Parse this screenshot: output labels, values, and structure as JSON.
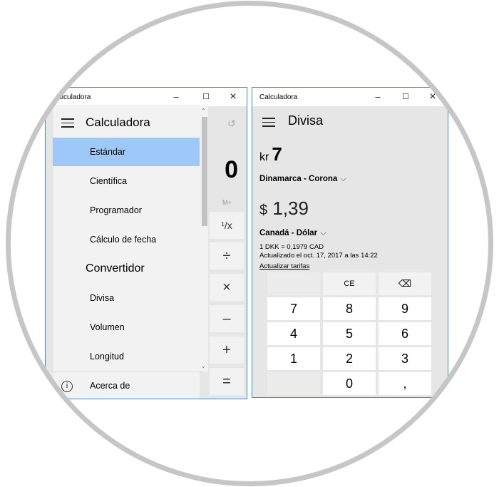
{
  "standard_window": {
    "title": "Calculadora",
    "controls": {
      "minimize": "–",
      "maximize": "☐",
      "close": "×"
    },
    "display": {
      "value": "0",
      "memory": "M+"
    },
    "history_icon": "history-icon",
    "operators": [
      "¹/x",
      "÷",
      "×",
      "–",
      "+",
      "="
    ],
    "nav": {
      "title": "Calculadora",
      "calc_items": [
        "Estándar",
        "Científica",
        "Programador",
        "Cálculo de fecha"
      ],
      "selected": "Estándar",
      "converter_header": "Convertidor",
      "converter_items": [
        "Divisa",
        "Volumen",
        "Longitud"
      ],
      "about": "Acerca de"
    }
  },
  "currency_window": {
    "title": "Calculadora",
    "controls": {
      "minimize": "–",
      "maximize": "☐",
      "close": "×"
    },
    "mode_title": "Divisa",
    "from": {
      "symbol": "kr",
      "value": "7",
      "currency": "Dinamarca - Corona"
    },
    "to": {
      "symbol": "$",
      "value": "1,39",
      "currency": "Canadá - Dólar"
    },
    "rate_line": "1 DKK = 0,1979 CAD",
    "updated_line": "Actualizado el oct. 17, 2017 a las 14:22",
    "update_link": "Actualizar tarifas",
    "keypad": {
      "ce": "CE",
      "backspace": "⌫",
      "digits": [
        "7",
        "8",
        "9",
        "4",
        "5",
        "6",
        "1",
        "2",
        "3",
        "0"
      ],
      "decimal": ","
    }
  }
}
